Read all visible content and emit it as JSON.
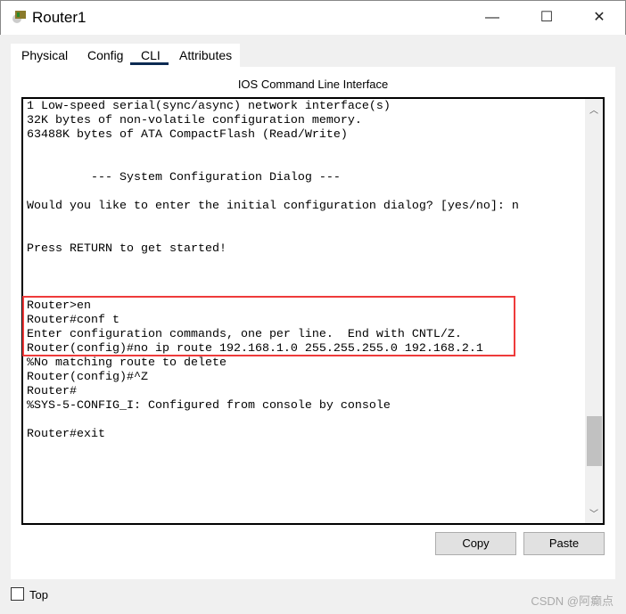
{
  "window": {
    "title": "Router1",
    "minimize": "—",
    "maximize": "☐",
    "close": "✕"
  },
  "tabs": [
    {
      "label": "Physical"
    },
    {
      "label": "Config"
    },
    {
      "label": "CLI",
      "active": true
    },
    {
      "label": "Attributes"
    }
  ],
  "cli": {
    "title": "IOS Command Line Interface",
    "lines": [
      "1 Low-speed serial(sync/async) network interface(s)",
      "32K bytes of non-volatile configuration memory.",
      "63488K bytes of ATA CompactFlash (Read/Write)",
      "",
      "",
      "         --- System Configuration Dialog ---",
      "",
      "Would you like to enter the initial configuration dialog? [yes/no]: n",
      "",
      "",
      "Press RETURN to get started!",
      "",
      "",
      "",
      "Router>en",
      "Router#conf t",
      "Enter configuration commands, one per line.  End with CNTL/Z.",
      "Router(config)#no ip route 192.168.1.0 255.255.255.0 192.168.2.1",
      "%No matching route to delete",
      "Router(config)#^Z",
      "Router#",
      "%SYS-5-CONFIG_I: Configured from console by console",
      "",
      "Router#exit"
    ],
    "highlight_color": "#ee3b3b"
  },
  "buttons": {
    "copy": "Copy",
    "paste": "Paste"
  },
  "footer": {
    "top_label": "Top",
    "top_checked": false,
    "watermark": "CSDN @阿癫点"
  }
}
